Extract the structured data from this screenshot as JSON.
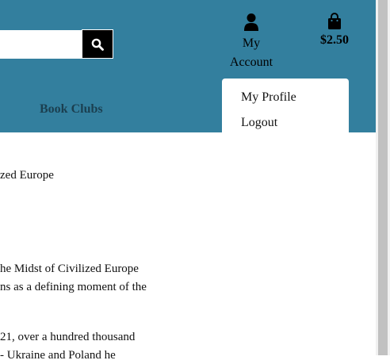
{
  "header": {
    "search": {
      "value": "",
      "placeholder": ""
    },
    "account": {
      "line1": "My",
      "line2": "Account"
    },
    "cart": {
      "total": "$2.50"
    },
    "nav": {
      "book_clubs": "Book Clubs"
    },
    "account_menu": {
      "items": [
        "My Profile",
        "Logout"
      ]
    }
  },
  "content": {
    "lines": [
      "zed Europe",
      "he Midst of Civilized Europe",
      "ns as a defining moment of the",
      "21, over a hundred thousand",
      "- Ukraine and Poland he"
    ]
  },
  "colors": {
    "header_bg": "#337f9e",
    "nav_text": "#1b3f50",
    "search_button": "#000000"
  },
  "icons": [
    "search-icon",
    "user-icon",
    "shopping-bag-icon"
  ]
}
